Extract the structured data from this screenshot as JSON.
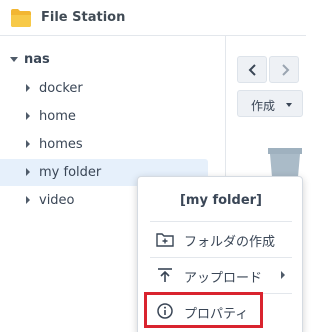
{
  "app": {
    "title": "File Station",
    "icon": "folder-icon",
    "accent": "#f5a623"
  },
  "sidebar": {
    "root_label": "nas",
    "items": [
      {
        "label": "docker"
      },
      {
        "label": "home"
      },
      {
        "label": "homes"
      },
      {
        "label": "my folder",
        "selected": true
      },
      {
        "label": "video"
      }
    ]
  },
  "toolbar": {
    "back_icon": "chevron-left-icon",
    "forward_icon": "chevron-right-icon",
    "create_label": "作成"
  },
  "context_menu": {
    "header": "[my folder]",
    "items": [
      {
        "label": "フォルダの作成",
        "icon": "create-folder-icon"
      },
      {
        "label": "アップロード",
        "icon": "upload-icon",
        "has_submenu": true
      },
      {
        "label": "プロパティ",
        "icon": "info-icon",
        "highlighted": true
      }
    ],
    "highlight_color": "#d9232e"
  }
}
